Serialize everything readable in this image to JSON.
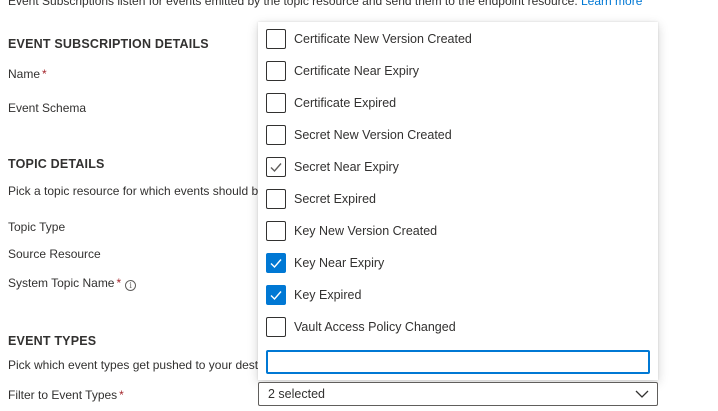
{
  "intro": {
    "text": "Event Subscriptions listen for events emitted by the topic resource and send them to the endpoint resource.",
    "learn_more": "Learn more"
  },
  "event_subscription_details": {
    "title": "EVENT SUBSCRIPTION DETAILS",
    "name_label": "Name",
    "schema_label": "Event Schema"
  },
  "topic_details": {
    "title": "TOPIC DETAILS",
    "description": "Pick a topic resource for which events should be",
    "topic_type_label": "Topic Type",
    "source_resource_label": "Source Resource",
    "system_topic_label": "System Topic Name"
  },
  "event_types": {
    "title": "EVENT TYPES",
    "description": "Pick which event types get pushed to your dest",
    "filter_label": "Filter to Event Types",
    "selected_text": "2 selected"
  },
  "required_mark": "*",
  "info_icon_glyph": "i",
  "dropdown": {
    "options": [
      {
        "label": "Certificate New Version Created",
        "state": "unchecked"
      },
      {
        "label": "Certificate Near Expiry",
        "state": "unchecked"
      },
      {
        "label": "Certificate Expired",
        "state": "unchecked"
      },
      {
        "label": "Secret New Version Created",
        "state": "unchecked"
      },
      {
        "label": "Secret Near Expiry",
        "state": "hover"
      },
      {
        "label": "Secret Expired",
        "state": "unchecked"
      },
      {
        "label": "Key New Version Created",
        "state": "unchecked"
      },
      {
        "label": "Key Near Expiry",
        "state": "checked"
      },
      {
        "label": "Key Expired",
        "state": "checked"
      },
      {
        "label": "Vault Access Policy Changed",
        "state": "unchecked"
      }
    ],
    "filter_value": ""
  },
  "colors": {
    "accent": "#0078d4",
    "required": "#a4262c",
    "text": "#323130"
  }
}
